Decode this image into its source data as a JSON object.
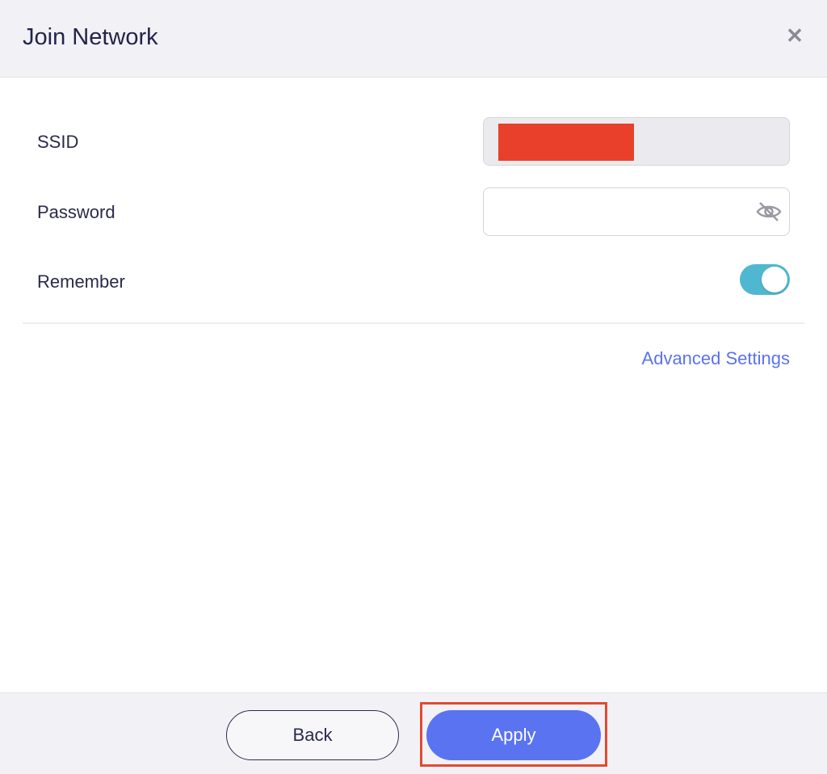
{
  "dialog": {
    "title": "Join Network",
    "close_icon": "close-icon"
  },
  "form": {
    "ssid_label": "SSID",
    "ssid_value_redacted": true,
    "password_label": "Password",
    "password_value": "",
    "password_icon": "eye-slash-icon",
    "remember_label": "Remember",
    "remember_enabled": true,
    "advanced_link": "Advanced Settings"
  },
  "footer": {
    "back_label": "Back",
    "apply_label": "Apply"
  },
  "colors": {
    "accent": "#5a73f0",
    "toggle_on": "#4fb8d0",
    "link": "#5b72ee",
    "redaction": "#e8402a",
    "highlight_border": "#e24a32"
  }
}
